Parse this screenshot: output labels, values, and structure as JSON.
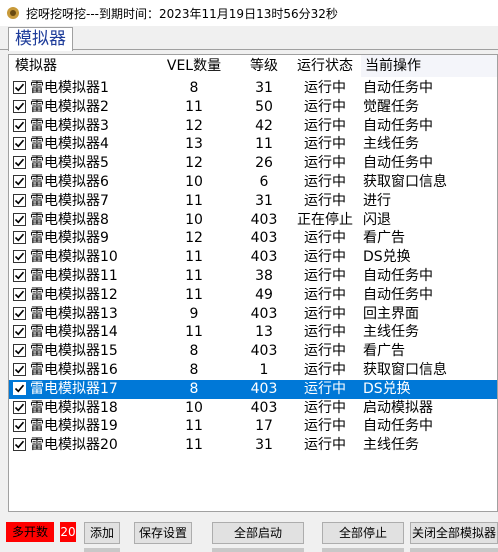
{
  "window": {
    "title": "挖呀挖呀挖---到期时间：2023年11月19日13时56分32秒"
  },
  "tabs": [
    {
      "label": "模拟器"
    }
  ],
  "table": {
    "columns": [
      "模拟器",
      "VEL数量",
      "等级",
      "运行状态",
      "当前操作"
    ],
    "selected_index": 16,
    "rows": [
      {
        "name": "雷电模拟器1",
        "vel": "8",
        "level": "31",
        "status": "运行中",
        "op": "自动任务中"
      },
      {
        "name": "雷电模拟器2",
        "vel": "11",
        "level": "50",
        "status": "运行中",
        "op": "觉醒任务"
      },
      {
        "name": "雷电模拟器3",
        "vel": "12",
        "level": "42",
        "status": "运行中",
        "op": "自动任务中"
      },
      {
        "name": "雷电模拟器4",
        "vel": "13",
        "level": "11",
        "status": "运行中",
        "op": "主线任务"
      },
      {
        "name": "雷电模拟器5",
        "vel": "12",
        "level": "26",
        "status": "运行中",
        "op": "自动任务中"
      },
      {
        "name": "雷电模拟器6",
        "vel": "10",
        "level": "6",
        "status": "运行中",
        "op": "获取窗口信息"
      },
      {
        "name": "雷电模拟器7",
        "vel": "11",
        "level": "31",
        "status": "运行中",
        "op": "进行"
      },
      {
        "name": "雷电模拟器8",
        "vel": "10",
        "level": "403",
        "status": "正在停止",
        "op": "闪退"
      },
      {
        "name": "雷电模拟器9",
        "vel": "12",
        "level": "403",
        "status": "运行中",
        "op": "看广告"
      },
      {
        "name": "雷电模拟器10",
        "vel": "11",
        "level": "403",
        "status": "运行中",
        "op": "DS兑换"
      },
      {
        "name": "雷电模拟器11",
        "vel": "11",
        "level": "38",
        "status": "运行中",
        "op": "自动任务中"
      },
      {
        "name": "雷电模拟器12",
        "vel": "11",
        "level": "49",
        "status": "运行中",
        "op": "自动任务中"
      },
      {
        "name": "雷电模拟器13",
        "vel": "9",
        "level": "403",
        "status": "运行中",
        "op": "回主界面"
      },
      {
        "name": "雷电模拟器14",
        "vel": "11",
        "level": "13",
        "status": "运行中",
        "op": "主线任务"
      },
      {
        "name": "雷电模拟器15",
        "vel": "8",
        "level": "403",
        "status": "运行中",
        "op": "看广告"
      },
      {
        "name": "雷电模拟器16",
        "vel": "8",
        "level": "1",
        "status": "运行中",
        "op": "获取窗口信息"
      },
      {
        "name": "雷电模拟器17",
        "vel": "8",
        "level": "403",
        "status": "运行中",
        "op": "DS兑换"
      },
      {
        "name": "雷电模拟器18",
        "vel": "10",
        "level": "403",
        "status": "运行中",
        "op": "启动模拟器"
      },
      {
        "name": "雷电模拟器19",
        "vel": "11",
        "level": "17",
        "status": "运行中",
        "op": "自动任务中"
      },
      {
        "name": "雷电模拟器20",
        "vel": "11",
        "level": "31",
        "status": "运行中",
        "op": "主线任务"
      }
    ]
  },
  "bottom": {
    "multi_label": "多开数",
    "multi_value": "20",
    "add_label": "添加",
    "save_label": "保存设置",
    "start_all_label": "全部启动",
    "stop_all_label": "全部停止",
    "close_all_label": "关闭全部模拟器"
  },
  "colors": {
    "selection": "#0078d7",
    "tab_text": "#1e3c9a",
    "alert_red": "#ff0000"
  }
}
